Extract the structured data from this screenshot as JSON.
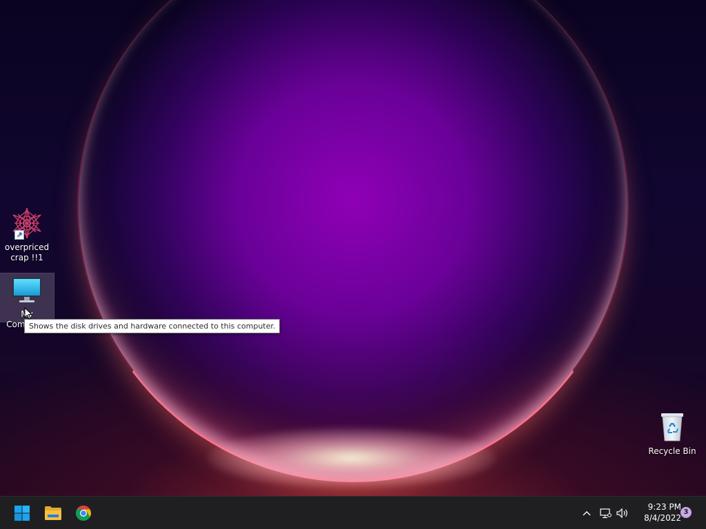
{
  "desktop": {
    "icons": [
      {
        "label": "overpriced crap !!1",
        "icon": "starburst-shortcut-icon"
      },
      {
        "label": "My Computer",
        "icon": "monitor-icon"
      },
      {
        "label": "Recycle Bin",
        "icon": "recycle-bin-icon"
      }
    ],
    "tooltip": "Shows the disk drives and hardware connected to this computer."
  },
  "taskbar": {
    "pinned": [
      {
        "name": "Start",
        "icon": "windows-logo-icon"
      },
      {
        "name": "File Explorer",
        "icon": "folder-icon"
      },
      {
        "name": "Google Chrome",
        "icon": "chrome-icon"
      }
    ],
    "tray": {
      "icons": [
        "chevron-up-icon",
        "network-icon",
        "volume-icon"
      ],
      "time": "9:23 PM",
      "date": "8/4/2022",
      "notification_count": "3"
    }
  },
  "colors": {
    "taskbar_bg": "#1f1f22",
    "windows_blue": "#1aa3f0",
    "folder_yellow": "#f5c043",
    "badge": "#c9a6e6"
  }
}
